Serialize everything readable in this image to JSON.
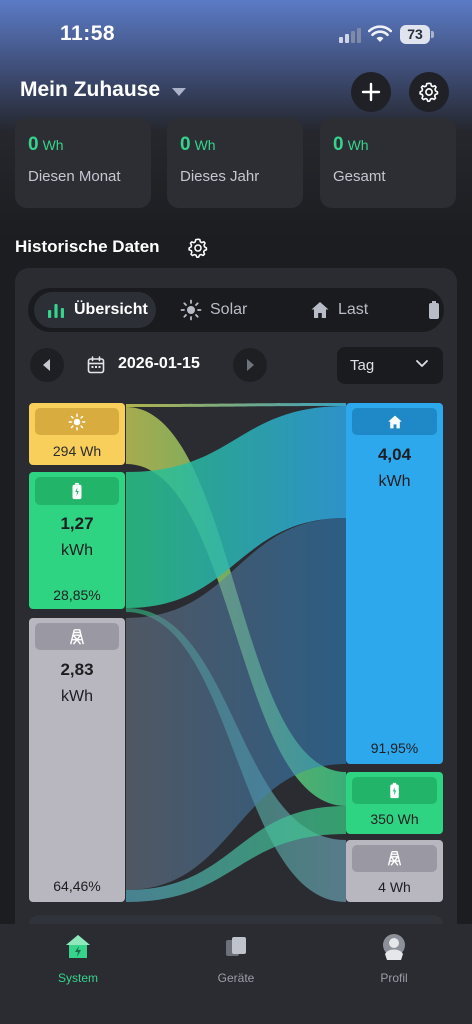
{
  "status_bar": {
    "time": "11:58",
    "battery": "73"
  },
  "header": {
    "title": "Mein Zuhause"
  },
  "stats": [
    {
      "value": "0",
      "unit": "Wh",
      "label": "Diesen Monat"
    },
    {
      "value": "0",
      "unit": "Wh",
      "label": "Dieses Jahr"
    },
    {
      "value": "0",
      "unit": "Wh",
      "label": "Gesamt"
    }
  ],
  "history": {
    "title": "Historische Daten",
    "tabs": [
      "Übersicht",
      "Solar",
      "Last"
    ],
    "date": "2026-01-15",
    "period": "Tag"
  },
  "sankey": {
    "sources": {
      "solar": {
        "value": "294 Wh"
      },
      "battery": {
        "value": "1,27",
        "unit": "kWh",
        "percent": "28,85%"
      },
      "grid": {
        "value": "2,83",
        "unit": "kWh",
        "percent": "64,46%"
      }
    },
    "targets": {
      "home": {
        "value": "4,04",
        "unit": "kWh",
        "percent": "91,95%"
      },
      "battery": {
        "value": "350 Wh"
      },
      "grid": {
        "value": "4 Wh"
      }
    }
  },
  "colors": {
    "accent": "#35d38c",
    "solar": "#f7cf5a",
    "battery": "#2fd482",
    "grid": "#b8b6bf",
    "home": "#2ea8ec"
  },
  "bottom_nav": [
    "System",
    "Geräte",
    "Profil"
  ]
}
